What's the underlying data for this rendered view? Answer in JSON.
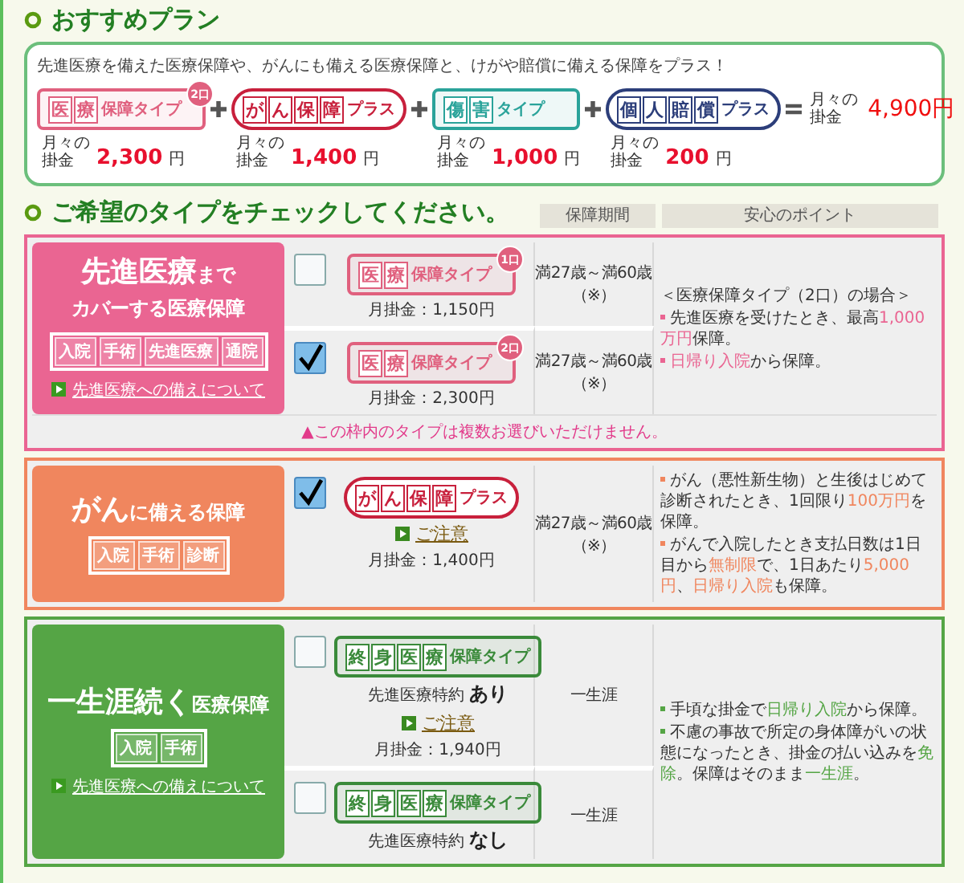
{
  "recommended": {
    "title": "おすすめプラン",
    "description": "先進医療を備えた医療保障や、がんにも備える医療保障と、けがや賠償に備える保障をプラス！",
    "plans": [
      {
        "kind": "box",
        "color": "#e0607e",
        "chars": [
          "医",
          "療"
        ],
        "suffix": "保障タイプ",
        "count": "2口",
        "fee_label": [
          "月々の",
          "掛金"
        ],
        "amount": "2,300",
        "unit": "円"
      },
      {
        "kind": "pill",
        "color": "#c8203c",
        "chars": [
          "が",
          "ん",
          "保",
          "障"
        ],
        "suffix": "プラス",
        "fee_label": [
          "月々の",
          "掛金"
        ],
        "amount": "1,400",
        "unit": "円"
      },
      {
        "kind": "box",
        "color": "#2aa39a",
        "chars": [
          "傷",
          "害"
        ],
        "suffix": "タイプ",
        "fee_label": [
          "月々の",
          "掛金"
        ],
        "amount": "1,000",
        "unit": "円"
      },
      {
        "kind": "pill",
        "color": "#2c3e7a",
        "chars": [
          "個",
          "人",
          "賠",
          "償"
        ],
        "suffix": "プラス",
        "fee_label": [
          "月々の",
          "掛金"
        ],
        "amount": "200",
        "unit": "円"
      }
    ],
    "total": {
      "fee_label": [
        "月々の",
        "掛金"
      ],
      "amount": "4,900円"
    }
  },
  "selection": {
    "title": "ご希望のタイプをチェックしてください。",
    "columns": [
      "保障期間",
      "安心のポイント"
    ],
    "groups": [
      {
        "color": "#ea6592",
        "title_big": "先進医療",
        "title_small": "まで",
        "subtitle": "カバーする医療保障",
        "tags": [
          "入院",
          "手術",
          "先進医療",
          "通院"
        ],
        "link": "先進医療への備えについて",
        "options": [
          {
            "checked": false,
            "badge": {
              "kind": "box",
              "color": "#e0607e",
              "chars": [
                "医",
                "療"
              ],
              "suffix": "保障タイプ",
              "count": "1口"
            },
            "fee": "月掛金：1,150円",
            "period": "満27歳～満60歳",
            "period_note": "（※）"
          },
          {
            "checked": true,
            "badge": {
              "kind": "box",
              "color": "#e0607e",
              "chars": [
                "医",
                "療"
              ],
              "suffix": "保障タイプ",
              "count": "2口"
            },
            "fee": "月掛金：2,300円",
            "period": "満27歳～満60歳",
            "period_note": "（※）"
          }
        ],
        "points": [
          {
            "kind": "heading",
            "text": "＜医療保障タイプ（2口）の場合＞"
          },
          {
            "kind": "bullet",
            "text": "先進医療を受けたとき、最高**1,000万円**保障。"
          },
          {
            "kind": "bullet",
            "text": "**日帰り入院**から保障。"
          }
        ],
        "footnote": "▲この枠内のタイプは複数お選びいただけません。"
      },
      {
        "color": "#f0865e",
        "title_big": "がん",
        "title_small": "に備える保障",
        "tags": [
          "入院",
          "手術",
          "診断"
        ],
        "options": [
          {
            "checked": true,
            "badge": {
              "kind": "pill",
              "color": "#c8203c",
              "chars": [
                "が",
                "ん",
                "保",
                "障"
              ],
              "suffix": "プラス"
            },
            "caution": "ご注意",
            "fee": "月掛金：1,400円",
            "period": "満27歳～満60歳",
            "period_note": "（※）"
          }
        ],
        "points": [
          {
            "kind": "bullet",
            "text": "がん（悪性新生物）と生後はじめて診断されたとき、1回限り**100万円**を保障。"
          },
          {
            "kind": "bullet",
            "text": "がんで入院したとき支払日数は1日目から**無制限**で、1日あたり**5,000円**、**日帰り入院**も保障。"
          }
        ]
      },
      {
        "color": "#55a545",
        "title_big": "一生涯続く",
        "title_small": "医療保障",
        "tags": [
          "入院",
          "手術"
        ],
        "link": "先進医療への備えについて",
        "options": [
          {
            "checked": false,
            "badge": {
              "kind": "box",
              "color": "#3a8a3a",
              "chars": [
                "終",
                "身",
                "医",
                "療"
              ],
              "suffix": "保障タイプ"
            },
            "note_label": "先進医療特約",
            "note_value": "あり",
            "caution": "ご注意",
            "fee": "月掛金：1,940円",
            "period": "一生涯"
          },
          {
            "checked": false,
            "badge": {
              "kind": "box",
              "color": "#3a8a3a",
              "chars": [
                "終",
                "身",
                "医",
                "療"
              ],
              "suffix": "保障タイプ"
            },
            "note_label": "先進医療特約",
            "note_value": "なし",
            "period": "一生涯"
          }
        ],
        "points": [
          {
            "kind": "bullet",
            "text": "手頃な掛金で**日帰り入院**から保障。"
          },
          {
            "kind": "bullet",
            "text": "不慮の事故で所定の身体障がいの状態になったとき、掛金の払い込みを**免除**。保障はそのまま**一生涯**。"
          }
        ]
      }
    ]
  }
}
